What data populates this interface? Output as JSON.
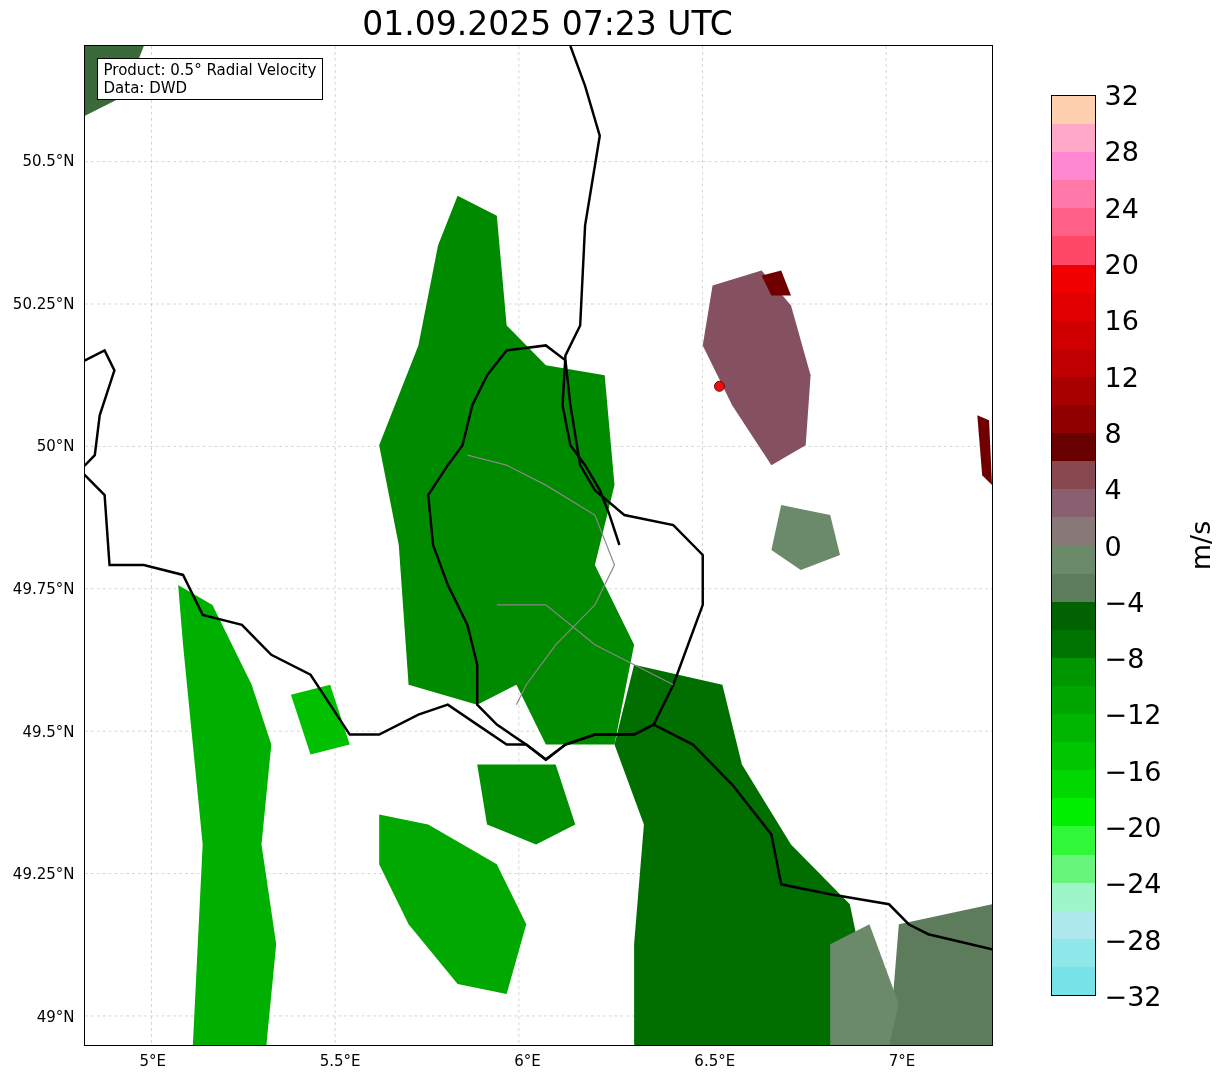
{
  "title": "01.09.2025 07:23 UTC",
  "info": [
    "Product: 0.5° Radial Velocity",
    "Data: DWD"
  ],
  "map": {
    "lat_ticks": [
      "50.5°N",
      "50.25°N",
      "50°N",
      "49.75°N",
      "49.5°N",
      "49.25°N",
      "49°N"
    ],
    "lon_ticks": [
      "5°E",
      "5.5°E",
      "6°E",
      "6.5°E",
      "7°E"
    ]
  },
  "colorbar": {
    "label": "m/s",
    "ticks": [
      "32",
      "28",
      "24",
      "20",
      "16",
      "12",
      "8",
      "4",
      "0",
      "−4",
      "−8",
      "−12",
      "−16",
      "−20",
      "−24",
      "−28",
      "−32"
    ],
    "bins": [
      {
        "color": "#ffd0b0"
      },
      {
        "color": "#ffa8c8"
      },
      {
        "color": "#ff88d0"
      },
      {
        "color": "#ff78a8"
      },
      {
        "color": "#ff6088"
      },
      {
        "color": "#ff4868"
      },
      {
        "color": "#f00000"
      },
      {
        "color": "#e00000"
      },
      {
        "color": "#d00000"
      },
      {
        "color": "#c00000"
      },
      {
        "color": "#a80000"
      },
      {
        "color": "#900000"
      },
      {
        "color": "#680000"
      },
      {
        "color": "#884850"
      },
      {
        "color": "#886070"
      },
      {
        "color": "#887878"
      },
      {
        "color": "#6a8a6a"
      },
      {
        "color": "#5c7c5c"
      },
      {
        "color": "#006200"
      },
      {
        "color": "#007400"
      },
      {
        "color": "#009600"
      },
      {
        "color": "#00a600"
      },
      {
        "color": "#00b600"
      },
      {
        "color": "#00c600"
      },
      {
        "color": "#00d800"
      },
      {
        "color": "#00f000"
      },
      {
        "color": "#30f838"
      },
      {
        "color": "#66f57a"
      },
      {
        "color": "#9df5c8"
      },
      {
        "color": "#ace8ec"
      },
      {
        "color": "#8ee8ea"
      },
      {
        "color": "#77e3e8"
      }
    ]
  }
}
